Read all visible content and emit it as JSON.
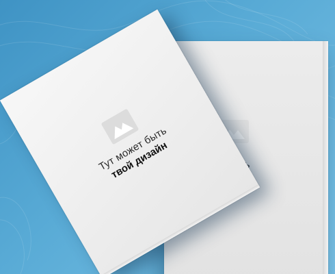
{
  "scene": {
    "background_color": "#4fa2d0",
    "booklet_color": "#efefef"
  },
  "front_booklet": {
    "icon": "image-placeholder-icon",
    "line1": "Тут может быть",
    "line2": "твой дизайн"
  },
  "back_booklet": {
    "icon": "image-placeholder-icon",
    "partial_text": "ыть"
  }
}
